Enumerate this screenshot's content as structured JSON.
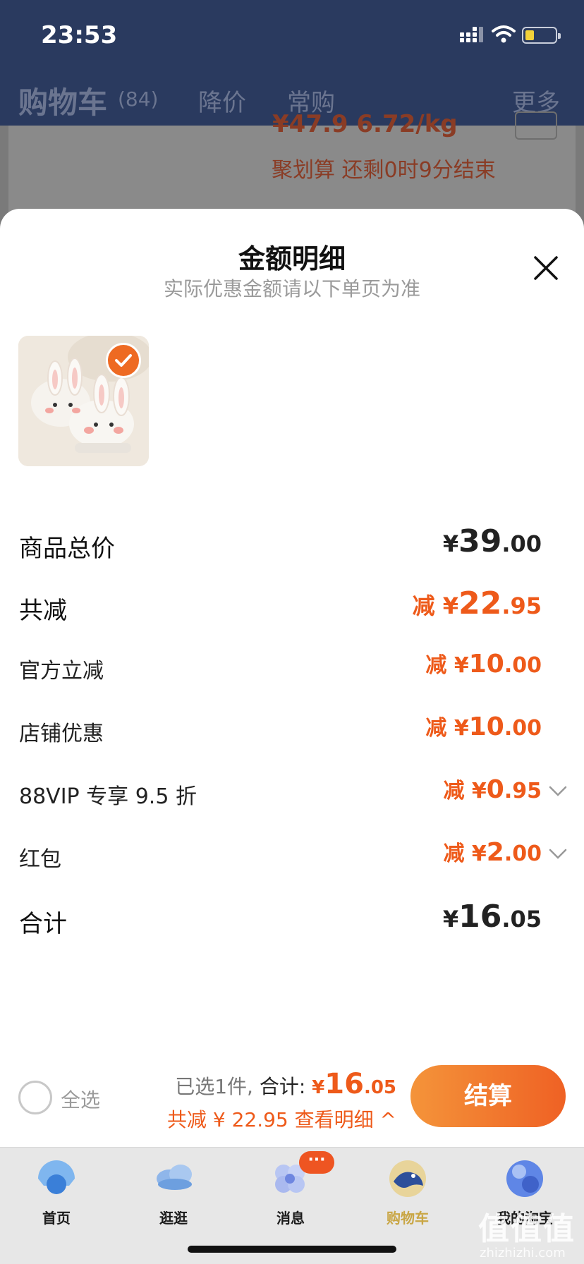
{
  "status_bar": {
    "time": "23:53"
  },
  "nav": {
    "title": "购物车",
    "count": "(84)",
    "tab_price_drop": "降价",
    "tab_frequent": "常购",
    "more": "更多"
  },
  "behind": {
    "price": "¥47.9 6.72/kg",
    "juhuasuan": "聚划算 还剩0时9分结束"
  },
  "sheet": {
    "title": "金额明细",
    "subtitle": "实际优惠金额请以下单页为准",
    "rows": [
      {
        "label": "商品总价",
        "prefix": "¥",
        "int": "39",
        "dec": ".00"
      },
      {
        "label": "共减",
        "prefix": "减 ¥",
        "int": "22",
        "dec": ".95"
      },
      {
        "label": "官方立减",
        "prefix": "减 ¥",
        "int": "10",
        "dec": ".00"
      },
      {
        "label": "店铺优惠",
        "prefix": "减 ¥",
        "int": "10",
        "dec": ".00"
      },
      {
        "label": "88VIP 专享 9.5 折",
        "prefix": "减 ¥",
        "int": "0",
        "dec": ".95"
      },
      {
        "label": "红包",
        "prefix": "减 ¥",
        "int": "2",
        "dec": ".00"
      },
      {
        "label": "合计",
        "prefix": "¥",
        "int": "16",
        "dec": ".05"
      }
    ]
  },
  "checkout": {
    "select_all": "全选",
    "selected": "已选1件,",
    "total_label": "合计:",
    "yen": "¥",
    "total_int": "16",
    "total_dec": ".05",
    "reduce_text": "共减 ¥ 22.95 查看明细 ^",
    "pay": "结算"
  },
  "tabbar": {
    "items": [
      {
        "label": "首页"
      },
      {
        "label": "逛逛"
      },
      {
        "label": "消息"
      },
      {
        "label": "购物车"
      },
      {
        "label": "我的淘宝"
      }
    ],
    "badge": "···"
  },
  "watermark": {
    "cn": "值值值",
    "en": "zhizhizhi.com"
  },
  "colors": {
    "accent": "#ee5a1a",
    "nav_bg": "#2a3a5f",
    "active_tab": "#c9a645"
  }
}
